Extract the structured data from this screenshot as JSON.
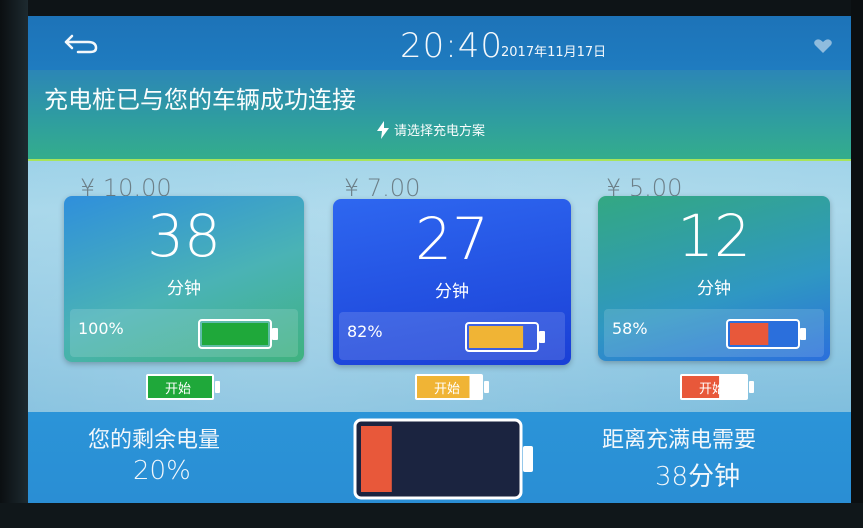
{
  "header": {
    "time": "20:40",
    "date": "2017年11月17日"
  },
  "banner": {
    "title": "充电桩已与您的车辆成功连接",
    "subtitle": "请选择充电方案"
  },
  "plans": [
    {
      "price": "¥ 10.00",
      "minutes": "38",
      "unit": "分钟",
      "percent_label": "100%",
      "level": 1.0,
      "color": "#1fa83a",
      "start_label": "开始"
    },
    {
      "price": "¥ 7.00",
      "minutes": "27",
      "unit": "分钟",
      "percent_label": "82%",
      "level": 0.82,
      "color": "#f0b435",
      "start_label": "开始"
    },
    {
      "price": "¥ 5.00",
      "minutes": "12",
      "unit": "分钟",
      "percent_label": "58%",
      "level": 0.58,
      "color": "#e8583a",
      "start_label": "开始"
    }
  ],
  "status": {
    "remaining_label": "您的剩余电量",
    "remaining_value": "20%",
    "remaining_level": 0.2,
    "full_label": "距离充满电需要",
    "full_value": "38分钟"
  },
  "colors": {
    "battery_low": "#e8583a",
    "battery_empty": "#1b2440"
  }
}
